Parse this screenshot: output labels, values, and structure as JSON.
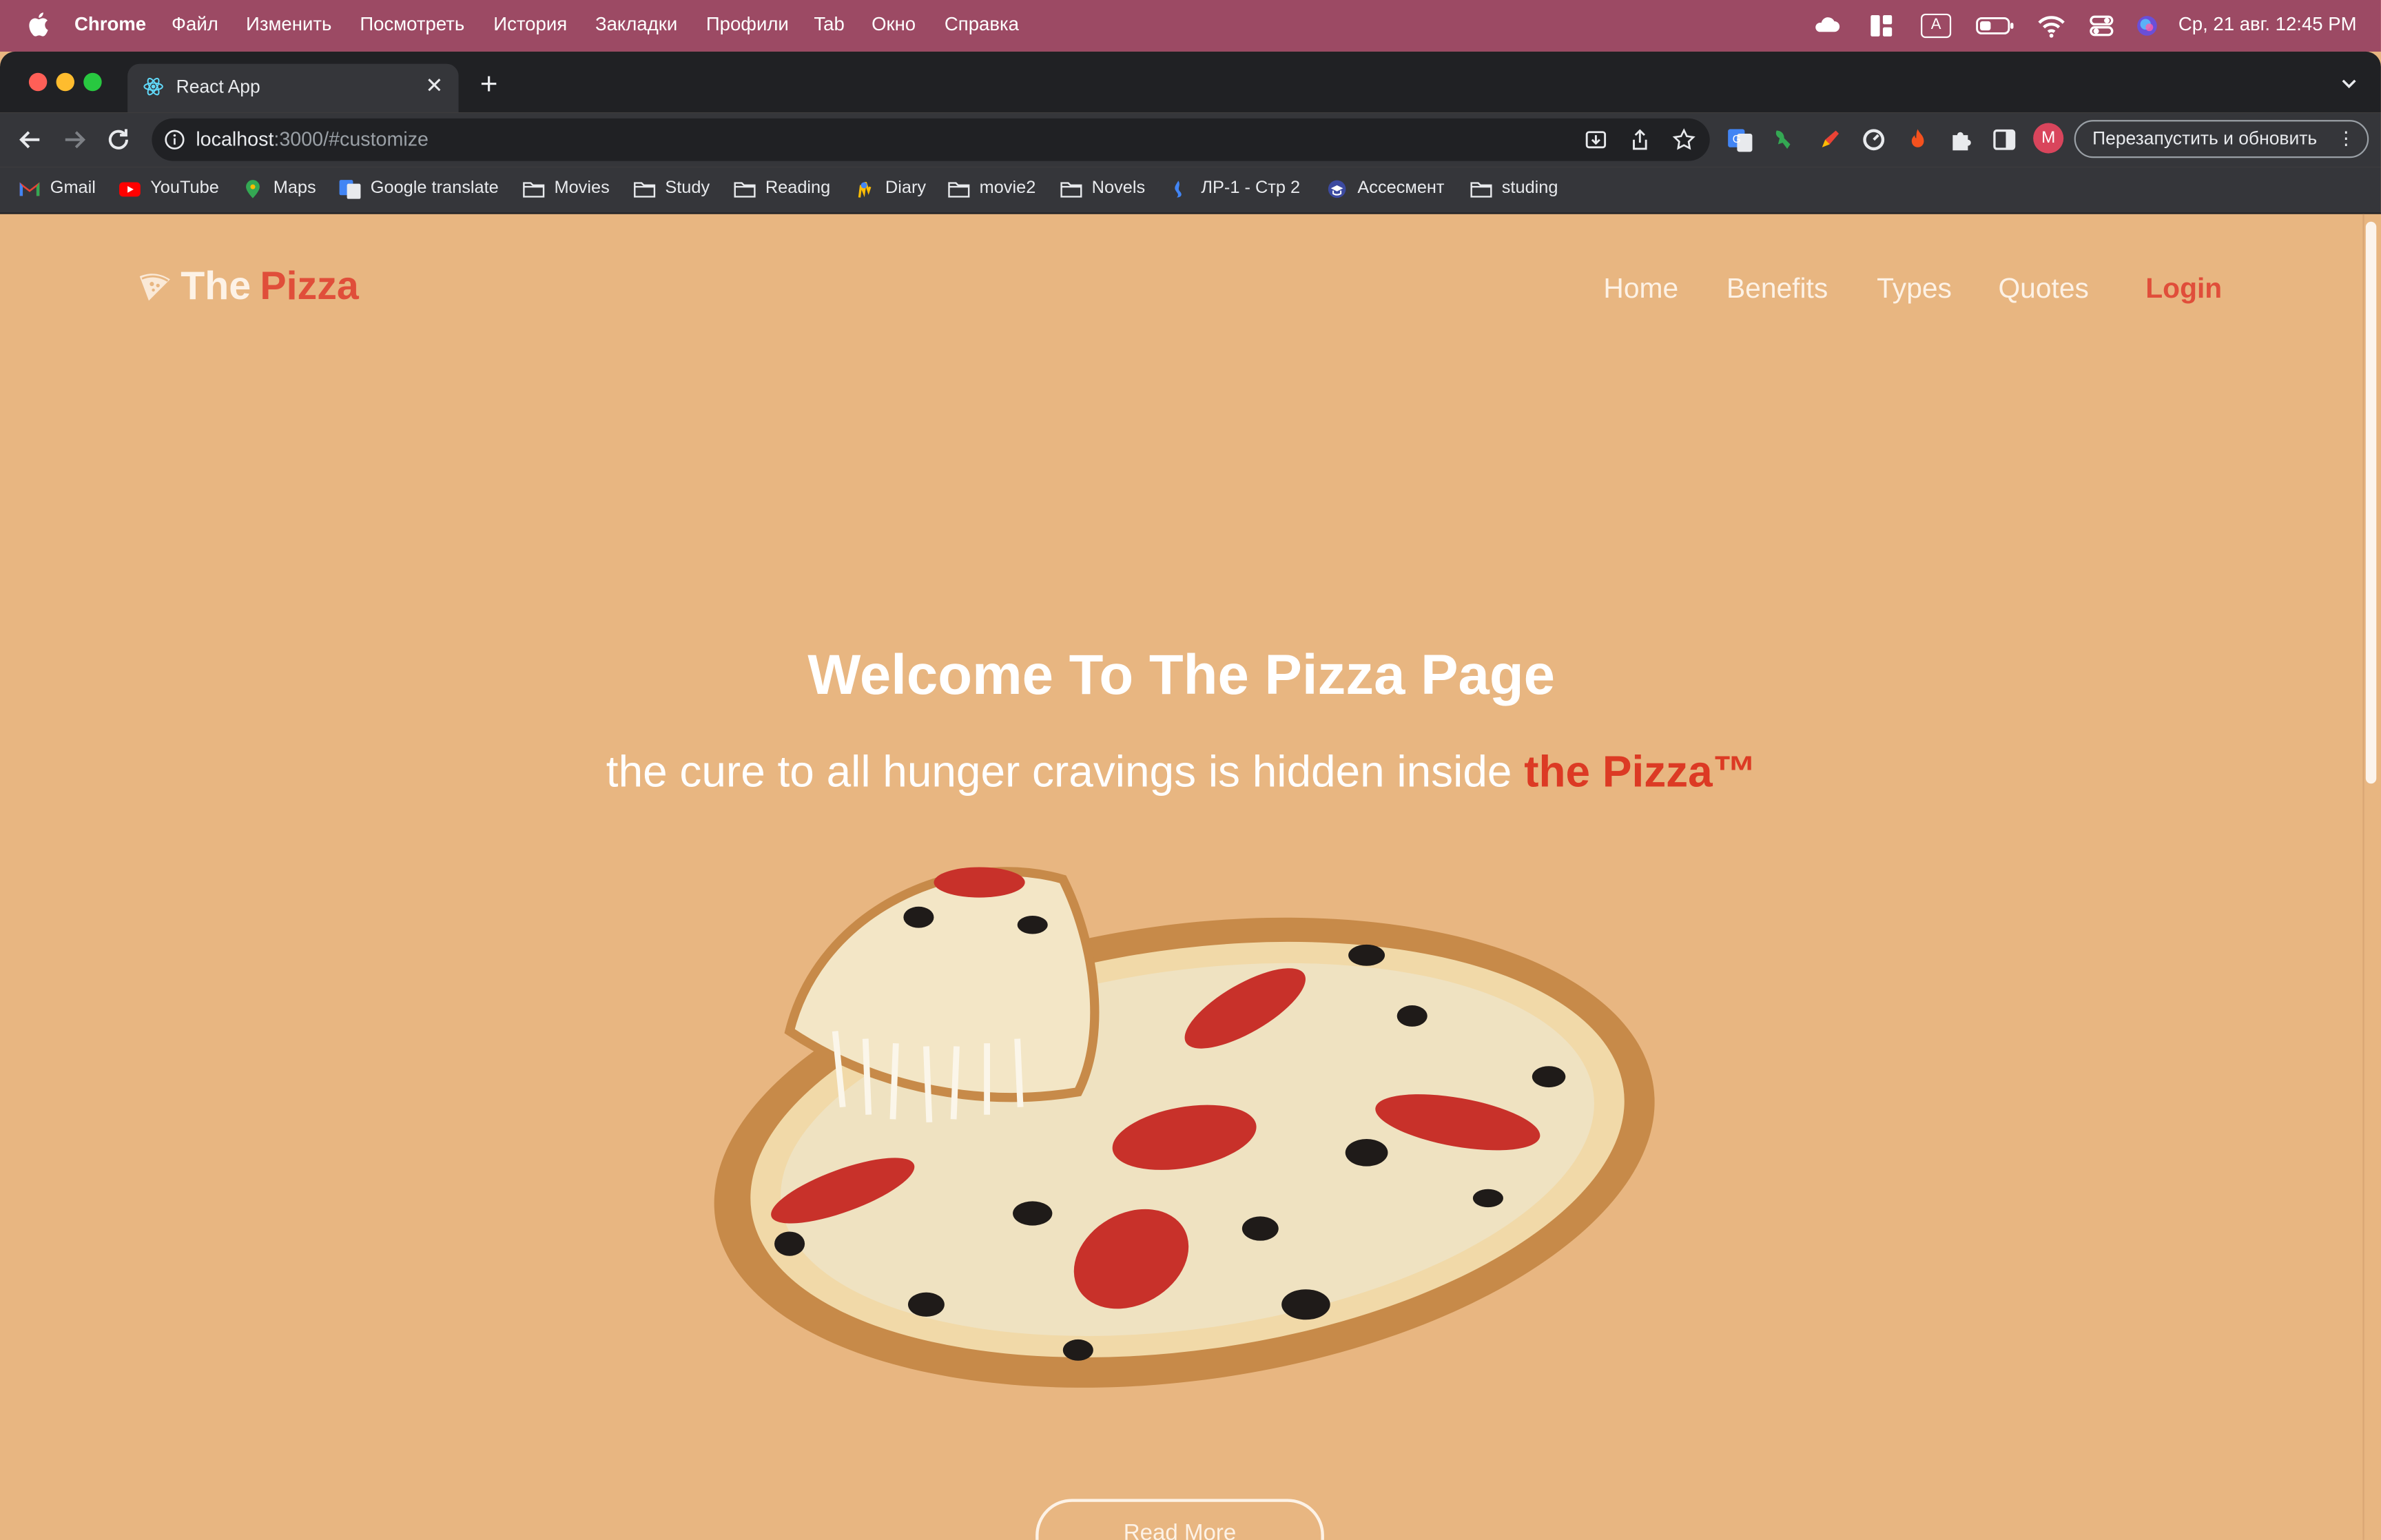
{
  "menubar": {
    "app": "Chrome",
    "items": [
      "Файл",
      "Изменить",
      "Посмотреть",
      "История",
      "Закладки",
      "Профили",
      "Tab",
      "Окно",
      "Справка"
    ],
    "clock": "Ср, 21 авг.  12:45 PM",
    "input_indicator": "A"
  },
  "browser": {
    "tab_title": "React App",
    "url_host": "localhost",
    "url_rest": ":3000/#customize",
    "profile_initial": "M",
    "relaunch_label": "Перезапустить и обновить",
    "bookmarks": [
      {
        "label": "Gmail",
        "icon": "gmail-icon"
      },
      {
        "label": "YouTube",
        "icon": "youtube-icon"
      },
      {
        "label": "Maps",
        "icon": "maps-icon"
      },
      {
        "label": "Google translate",
        "icon": "translate-icon"
      },
      {
        "label": "Movies",
        "icon": "folder-icon"
      },
      {
        "label": "Study",
        "icon": "folder-icon"
      },
      {
        "label": "Reading",
        "icon": "folder-icon"
      },
      {
        "label": "Diary",
        "icon": "diary-icon"
      },
      {
        "label": "movie2",
        "icon": "folder-icon"
      },
      {
        "label": "Novels",
        "icon": "folder-icon"
      },
      {
        "label": "ЛР-1 - Стр 2",
        "icon": "doc-icon"
      },
      {
        "label": "Ассесмент",
        "icon": "assessment-icon"
      },
      {
        "label": "studing",
        "icon": "folder-icon"
      }
    ]
  },
  "site": {
    "logo_part1": "The",
    "logo_part2": "Pizza",
    "nav": [
      "Home",
      "Benefits",
      "Types",
      "Quotes"
    ],
    "login": "Login",
    "hero_title": "Welcome To The Pizza Page",
    "hero_sub": "the cure to all hunger cravings is hidden inside",
    "hero_sub_accent": "the Pizza™",
    "read_more": "Read More"
  },
  "colors": {
    "page_bg": "#e8b681",
    "accent": "#e04e3a",
    "menubar": "#9c4a64"
  }
}
